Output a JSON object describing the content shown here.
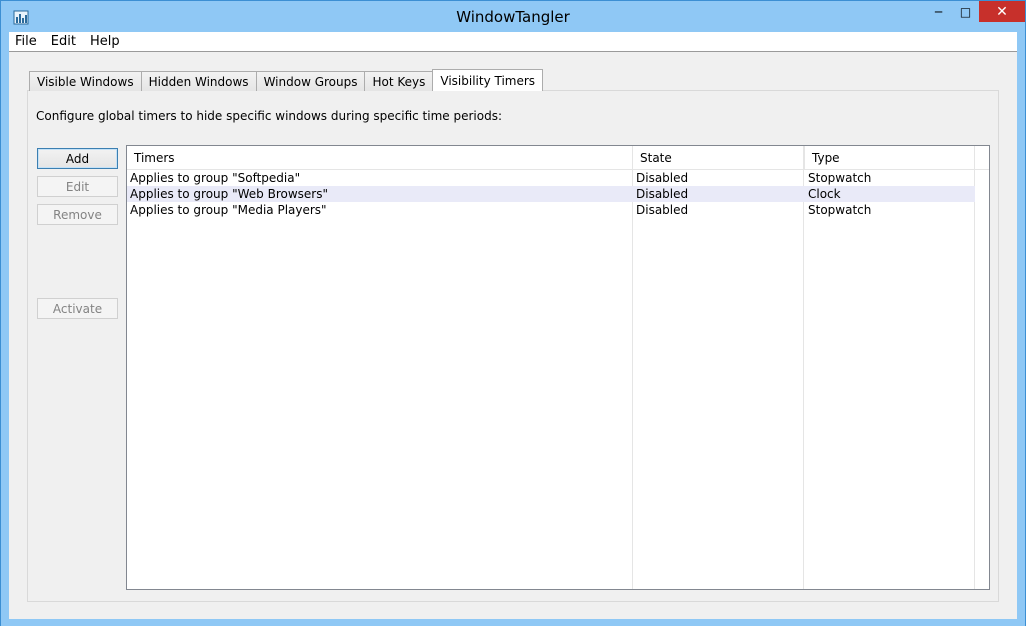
{
  "window": {
    "title": "WindowTangler",
    "controls": {
      "minimize": "─",
      "maximize": "□",
      "close": "✕"
    },
    "icon": "bar-chart-icon"
  },
  "menu": [
    {
      "label": "File"
    },
    {
      "label": "Edit"
    },
    {
      "label": "Help"
    }
  ],
  "tabs": [
    {
      "label": "Visible Windows",
      "active": false
    },
    {
      "label": "Hidden Windows",
      "active": false
    },
    {
      "label": "Window Groups",
      "active": false
    },
    {
      "label": "Hot Keys",
      "active": false
    },
    {
      "label": "Visibility Timers",
      "active": true
    }
  ],
  "panel": {
    "description": "Configure global timers to hide specific windows during specific time periods:",
    "buttons": {
      "add": "Add",
      "edit": "Edit",
      "remove": "Remove",
      "activate": "Activate"
    }
  },
  "list": {
    "columns": [
      "Timers",
      "State",
      "Type"
    ],
    "rows": [
      [
        "Applies to group \"Softpedia\"",
        "Disabled",
        "Stopwatch"
      ],
      [
        "Applies to group \"Web Browsers\"",
        "Disabled",
        "Clock"
      ],
      [
        "Applies to group \"Media Players\"",
        "Disabled",
        "Stopwatch"
      ]
    ]
  },
  "colors": {
    "titlebar": "#8fc8f5",
    "close_button": "#c7302b",
    "selected_row": "#e9eaf8"
  }
}
